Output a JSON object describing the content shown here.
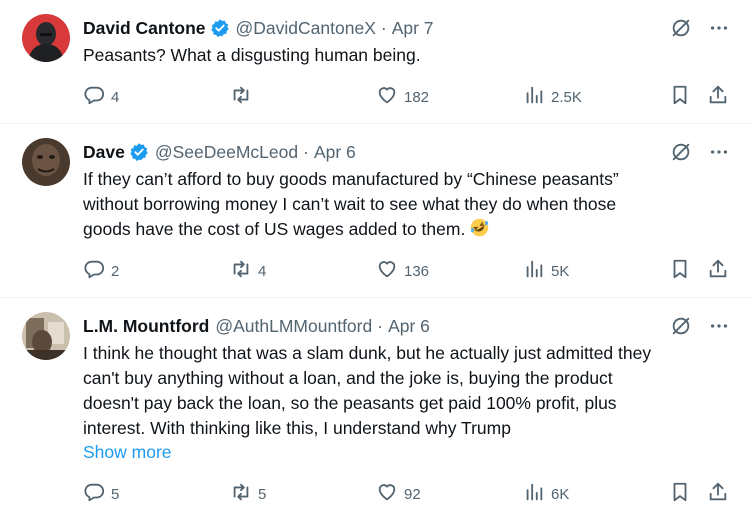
{
  "tweets": [
    {
      "name": "David Cantone",
      "handle": "@DavidCantoneX",
      "sep": "·",
      "date": "Apr 7",
      "lines": [
        "Peasants? What a disgusting human being."
      ],
      "show_more": "",
      "replies": "4",
      "retweets": "",
      "likes": "182",
      "views": "2.5K"
    },
    {
      "name": "Dave",
      "handle": "@SeeDeeMcLeod",
      "sep": "·",
      "date": "Apr 6",
      "lines": [
        "If they can’t afford to buy goods manufactured by “Chinese peasants”",
        "without borrowing money I can’t wait to see what they do when those",
        "goods have the cost of US wages added to them."
      ],
      "show_more": "",
      "replies": "2",
      "retweets": "4",
      "likes": "136",
      "views": "5K"
    },
    {
      "name": "L.M. Mountford",
      "handle": "@AuthLMMountford",
      "sep": "·",
      "date": "Apr 6",
      "lines": [
        "I think he thought that was a slam dunk, but he actually just admitted they",
        "can't buy anything without a loan, and the joke is, buying the product",
        "doesn't pay back the loan, so the peasants get paid 100% profit, plus",
        "interest. With thinking like this, I understand why Trump"
      ],
      "show_more": "Show more",
      "replies": "5",
      "retweets": "5",
      "likes": "92",
      "views": "6K"
    }
  ],
  "colors": {
    "text": "#0f1419",
    "secondary": "#536471",
    "link": "#1d9bf0",
    "verified": "#1d9bf0",
    "divider": "#eff3f4"
  },
  "icons": [
    "verified-badge-icon",
    "grok-icon",
    "more-icon",
    "reply-icon",
    "retweet-icon",
    "like-icon",
    "views-icon",
    "bookmark-icon",
    "share-icon",
    "rofl-emoji"
  ]
}
